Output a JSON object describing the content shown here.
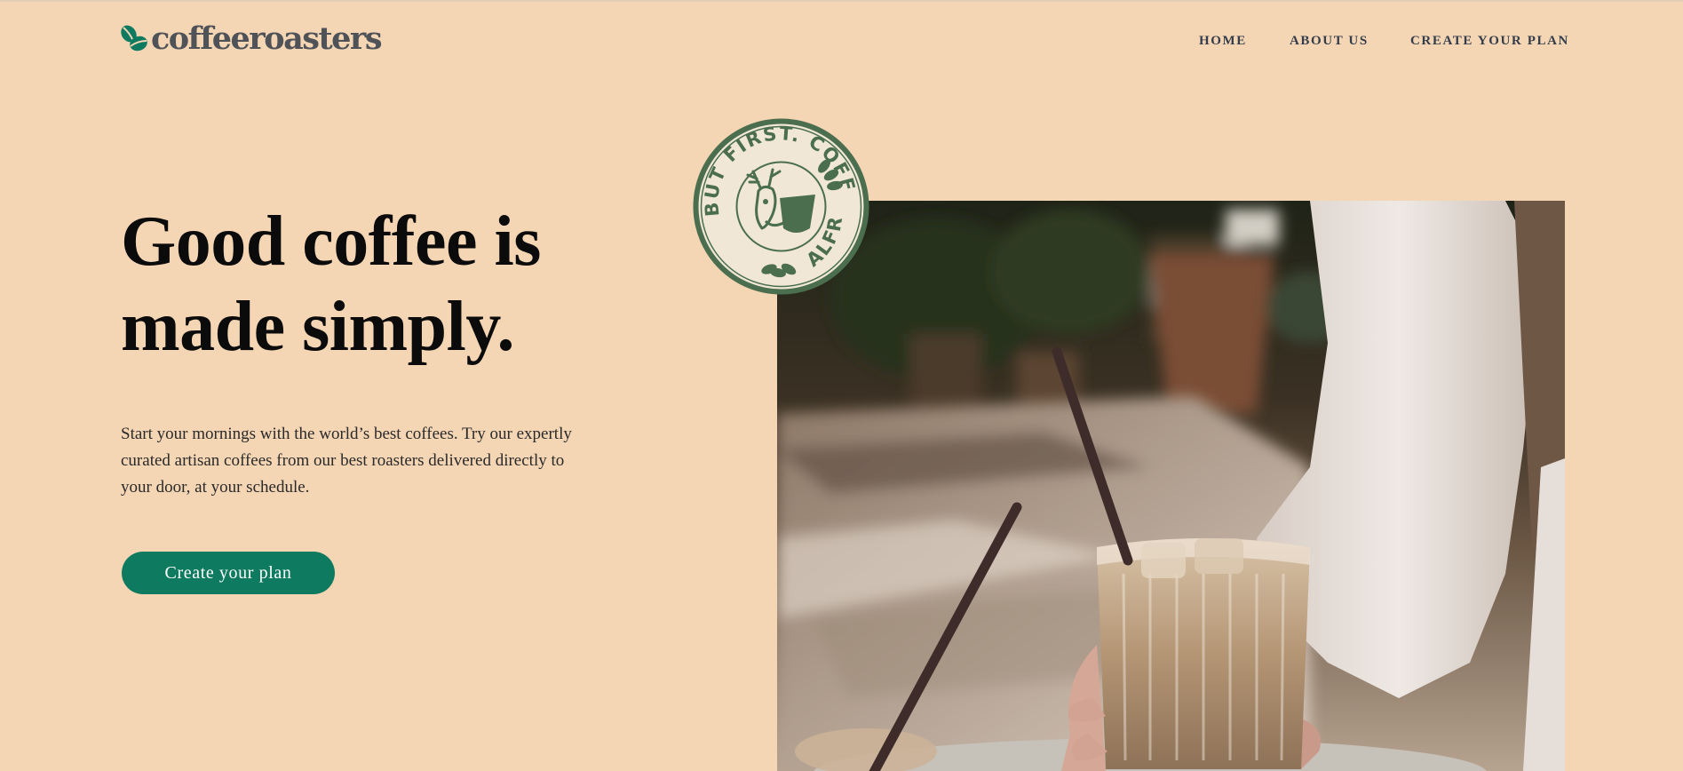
{
  "brand": {
    "name": "coffeeroasters",
    "accent_color": "#0E7A5F",
    "text_color": "#4F5358",
    "logo_icon": "coffee-bean-leaf-icon"
  },
  "nav": {
    "items": [
      {
        "label": "HOME"
      },
      {
        "label": "ABOUT US"
      },
      {
        "label": "CREATE YOUR PLAN"
      }
    ]
  },
  "hero": {
    "title_lines": [
      "Good coffee is",
      "made simply."
    ],
    "body_lines": [
      "Start your mornings with the world’s best coffees. Try our expertly",
      "curated artisan coffees from our best roasters delivered directly to",
      "your door, at your schedule."
    ],
    "cta_label": "Create your plan"
  },
  "badge": {
    "top_text": "BUT FIRST. COFFEE.",
    "bottom_text": "ALFRED",
    "color": "#4A6E4E",
    "icon": "deer-coffee-cup-icon"
  },
  "colors": {
    "background": "#F4D5B4",
    "button": "#0E7A5F",
    "heading": "#0B0B0B"
  }
}
